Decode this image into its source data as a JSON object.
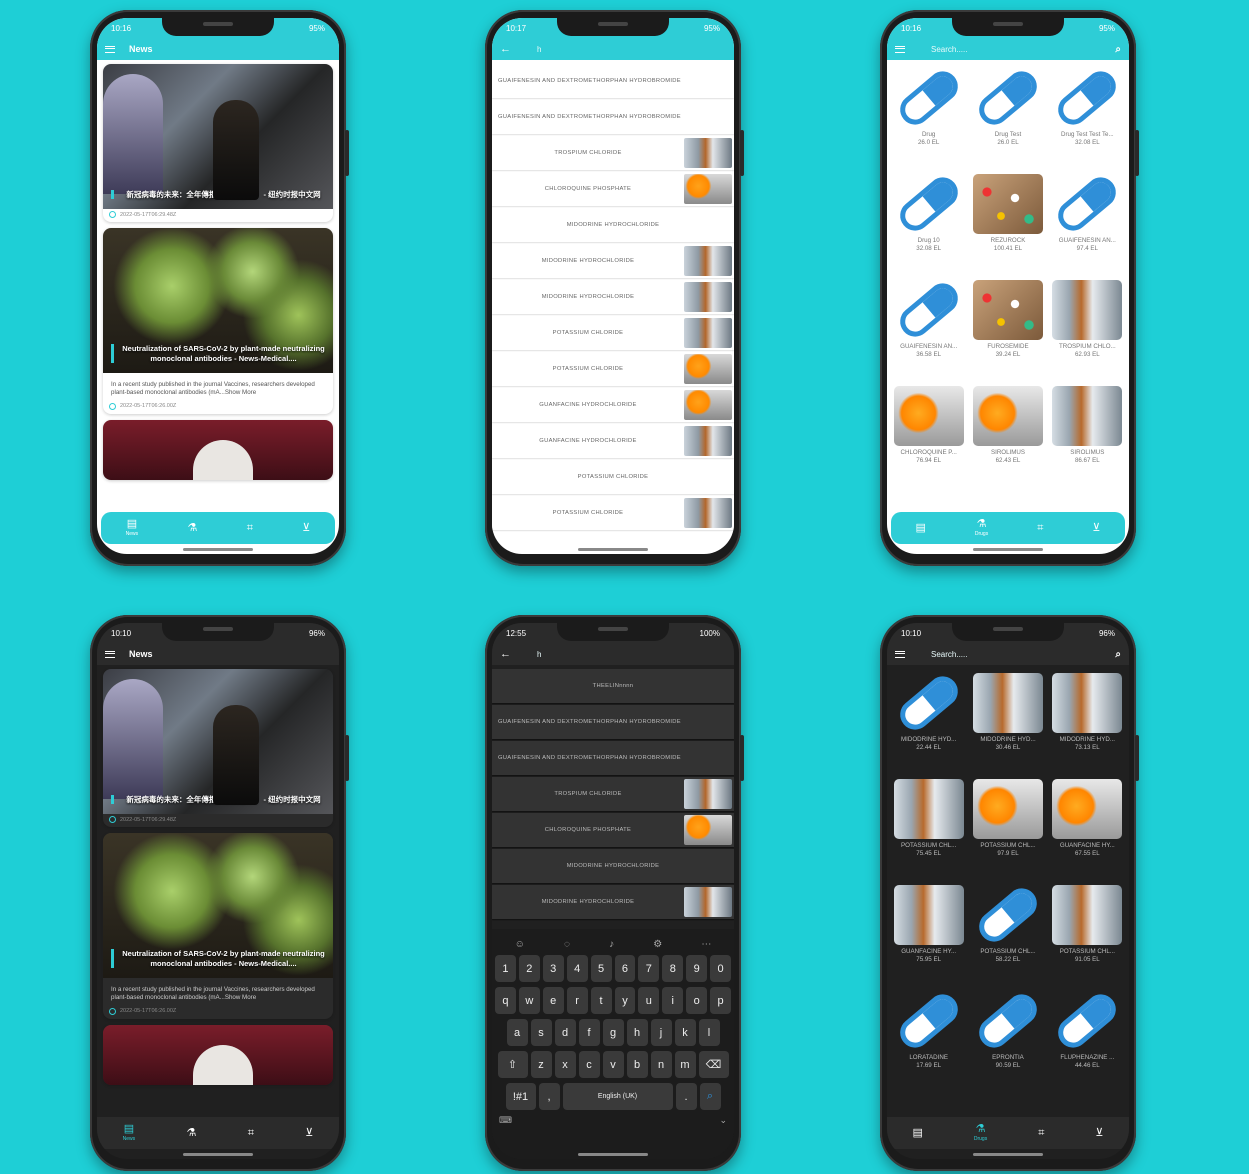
{
  "common": {
    "news_title": "News",
    "search_placeholder": "Search.....",
    "search_query": "h",
    "nav": [
      {
        "icon": "news-icon",
        "label": "News"
      },
      {
        "icon": "drugs-icon",
        "label": "Drugs"
      },
      {
        "icon": "scanner-icon",
        "label": ""
      },
      {
        "icon": "cart-icon",
        "label": ""
      }
    ]
  },
  "phones": [
    {
      "time": "10:16",
      "battery": "95%"
    },
    {
      "time": "10:17",
      "battery": "95%"
    },
    {
      "time": "10:16",
      "battery": "95%"
    },
    {
      "time": "10:10",
      "battery": "96%"
    },
    {
      "time": "12:55",
      "battery": "100%"
    },
    {
      "time": "10:10",
      "battery": "96%"
    }
  ],
  "news": [
    {
      "caption": "新冠病毒的未来：全年傳播，重複感染？ - 纽约时报中文网",
      "body": "",
      "date": "2022-05-17T06:29.48Z"
    },
    {
      "caption": "Neutralization of SARS-CoV-2 by plant-made neutralizing monoclonal antibodies - News-Medical....",
      "body": "In a recent study published in the journal Vaccines, researchers developed plant-based monoclonal antibodies (mA...Show More",
      "date": "2022-05-17T06:26.00Z"
    }
  ],
  "drug_list_light": [
    {
      "name": "GUAIFENESIN AND DEXTROMETHORPHAN HYDROBROMIDE",
      "thumb": ""
    },
    {
      "name": "GUAIFENESIN AND DEXTROMETHORPHAN HYDROBROMIDE",
      "thumb": ""
    },
    {
      "name": "TROSPIUM CHLORIDE",
      "thumb": "vial"
    },
    {
      "name": "CHLOROQUINE PHOSPHATE",
      "thumb": "pill"
    },
    {
      "name": "MIDODRINE HYDROCHLORIDE",
      "thumb": ""
    },
    {
      "name": "MIDODRINE HYDROCHLORIDE",
      "thumb": "vial"
    },
    {
      "name": "MIDODRINE HYDROCHLORIDE",
      "thumb": "vial"
    },
    {
      "name": "POTASSIUM CHLORIDE",
      "thumb": "vial"
    },
    {
      "name": "POTASSIUM CHLORIDE",
      "thumb": "pill"
    },
    {
      "name": "GUANFACINE HYDROCHLORIDE",
      "thumb": "pill"
    },
    {
      "name": "GUANFACINE HYDROCHLORIDE",
      "thumb": "vial"
    },
    {
      "name": "POTASSIUM CHLORIDE",
      "thumb": ""
    },
    {
      "name": "POTASSIUM CHLORIDE",
      "thumb": "vial"
    }
  ],
  "drug_list_dark": [
    {
      "name": "THEELINnnnn",
      "thumb": ""
    },
    {
      "name": "GUAIFENESIN AND DEXTROMETHORPHAN HYDROBROMIDE",
      "thumb": ""
    },
    {
      "name": "GUAIFENESIN AND DEXTROMETHORPHAN HYDROBROMIDE",
      "thumb": ""
    },
    {
      "name": "TROSPIUM CHLORIDE",
      "thumb": "vial"
    },
    {
      "name": "CHLOROQUINE PHOSPHATE",
      "thumb": "pill"
    },
    {
      "name": "MIDODRINE HYDROCHLORIDE",
      "thumb": ""
    },
    {
      "name": "MIDODRINE HYDROCHLORIDE",
      "thumb": "vial"
    }
  ],
  "drugs_grid_light": [
    {
      "name": "Drug",
      "price": "26.0 EL",
      "img": "capsule"
    },
    {
      "name": "Drug Test",
      "price": "26.0 EL",
      "img": "capsule"
    },
    {
      "name": "Drug Test Test Te...",
      "price": "32.08 EL",
      "img": "capsule"
    },
    {
      "name": "Drug 10",
      "price": "32.08 EL",
      "img": "capsule"
    },
    {
      "name": "REZUROCK",
      "price": "100.41 EL",
      "img": "pills"
    },
    {
      "name": "GUAIFENESIN AN...",
      "price": "97.4 EL",
      "img": "capsule"
    },
    {
      "name": "GUAIFENESIN AN...",
      "price": "36.58 EL",
      "img": "capsule"
    },
    {
      "name": "FUROSEMIDE",
      "price": "39.24 EL",
      "img": "pills"
    },
    {
      "name": "TROSPIUM CHLO...",
      "price": "62.93 EL",
      "img": "vial"
    },
    {
      "name": "CHLOROQUINE P...",
      "price": "76.94 EL",
      "img": "orange"
    },
    {
      "name": "SIROLIMUS",
      "price": "62.43 EL",
      "img": "orange"
    },
    {
      "name": "SIROLIMUS",
      "price": "86.67 EL",
      "img": "vial"
    }
  ],
  "drugs_grid_dark": [
    {
      "name": "MIDODRINE HYD...",
      "price": "22.44 EL",
      "img": "capsule"
    },
    {
      "name": "MIDODRINE HYD...",
      "price": "30.46 EL",
      "img": "vial"
    },
    {
      "name": "MIDODRINE HYD...",
      "price": "73.13 EL",
      "img": "vial"
    },
    {
      "name": "POTASSIUM CHL...",
      "price": "75.45 EL",
      "img": "vial"
    },
    {
      "name": "POTASSIUM CHL...",
      "price": "97.9 EL",
      "img": "orange"
    },
    {
      "name": "GUANFACINE HY...",
      "price": "67.55 EL",
      "img": "orange"
    },
    {
      "name": "GUANFACINE HY...",
      "price": "75.95 EL",
      "img": "vial"
    },
    {
      "name": "POTASSIUM CHL...",
      "price": "58.22 EL",
      "img": "capsule"
    },
    {
      "name": "POTASSIUM CHL...",
      "price": "91.05 EL",
      "img": "vial"
    },
    {
      "name": "LORATADINE",
      "price": "17.69 EL",
      "img": "capsule"
    },
    {
      "name": "EPRONTIA",
      "price": "90.59 EL",
      "img": "capsule"
    },
    {
      "name": "FLUPHENAZINE ...",
      "price": "44.46 EL",
      "img": "capsule"
    }
  ],
  "keyboard": {
    "numbers": [
      "1",
      "2",
      "3",
      "4",
      "5",
      "6",
      "7",
      "8",
      "9",
      "0"
    ],
    "row1": [
      "q",
      "w",
      "e",
      "r",
      "t",
      "y",
      "u",
      "i",
      "o",
      "p"
    ],
    "row2": [
      "a",
      "s",
      "d",
      "f",
      "g",
      "h",
      "j",
      "k",
      "l"
    ],
    "row3": [
      "z",
      "x",
      "c",
      "v",
      "b",
      "n",
      "m"
    ],
    "sym": "!#1",
    "comma": ",",
    "space": "English (UK)",
    "period": "."
  },
  "colors": {
    "accent": "#2ecdd6",
    "background": "#1ecfd6",
    "capsule": "#2f8fd8"
  }
}
